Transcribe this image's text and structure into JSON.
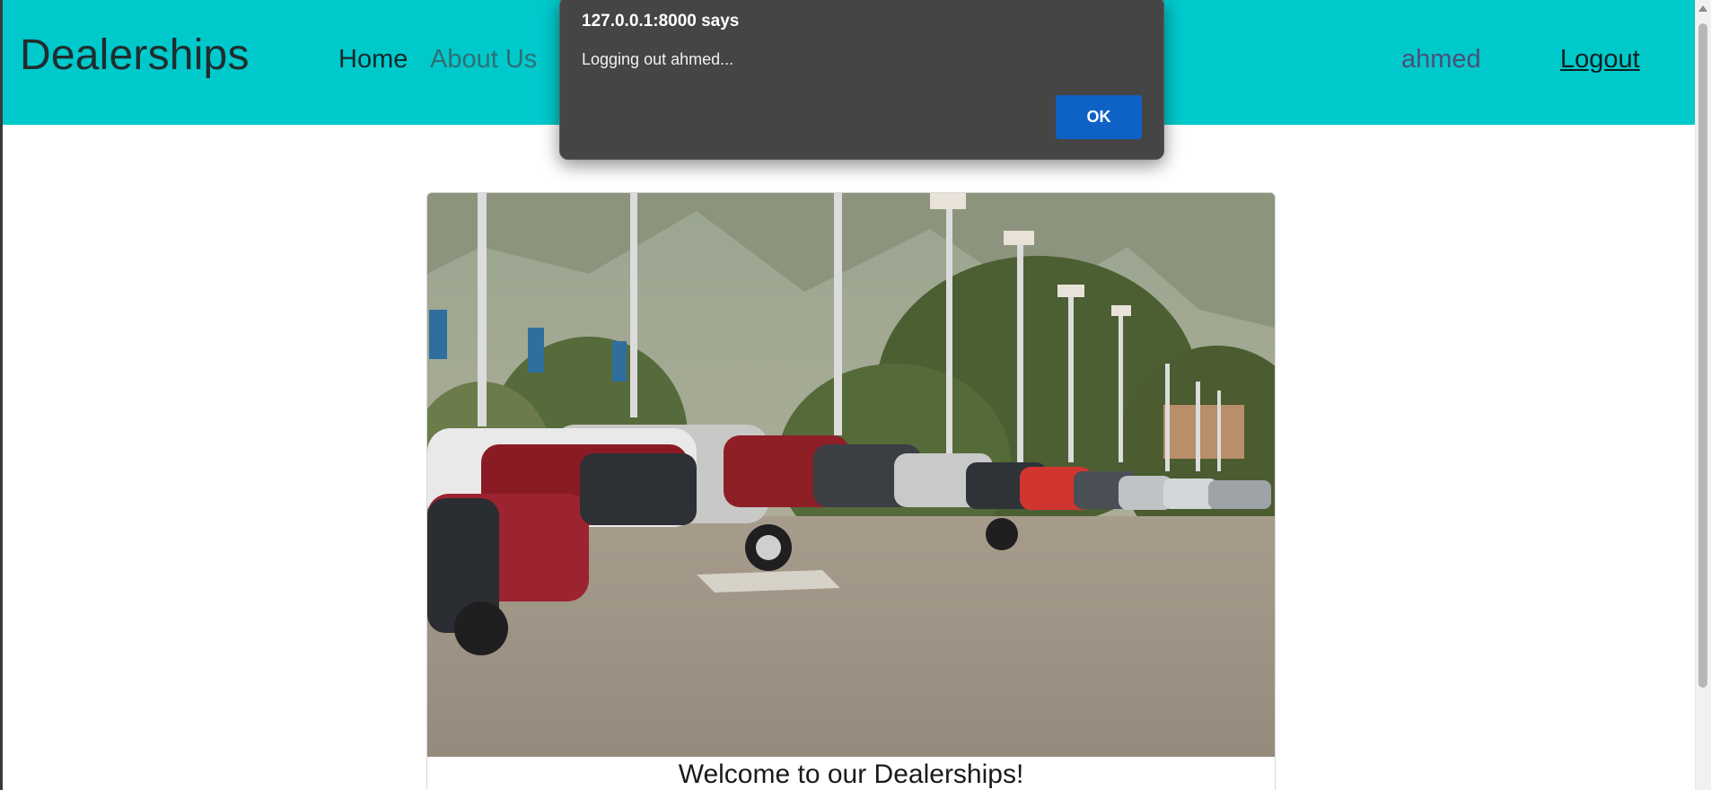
{
  "navbar": {
    "brand": "Dealerships",
    "links": {
      "home": "Home",
      "about": "About Us"
    },
    "user": "ahmed",
    "logout": "Logout"
  },
  "card": {
    "image_alt": "Car dealership parking lot",
    "title": "Welcome to our Dealerships!"
  },
  "dialog": {
    "origin": "127.0.0.1:8000 says",
    "message": "Logging out ahmed...",
    "ok_label": "OK"
  },
  "colors": {
    "navbar_bg": "#00c9cc",
    "dialog_bg": "#454545",
    "ok_button": "#0e62c6"
  }
}
